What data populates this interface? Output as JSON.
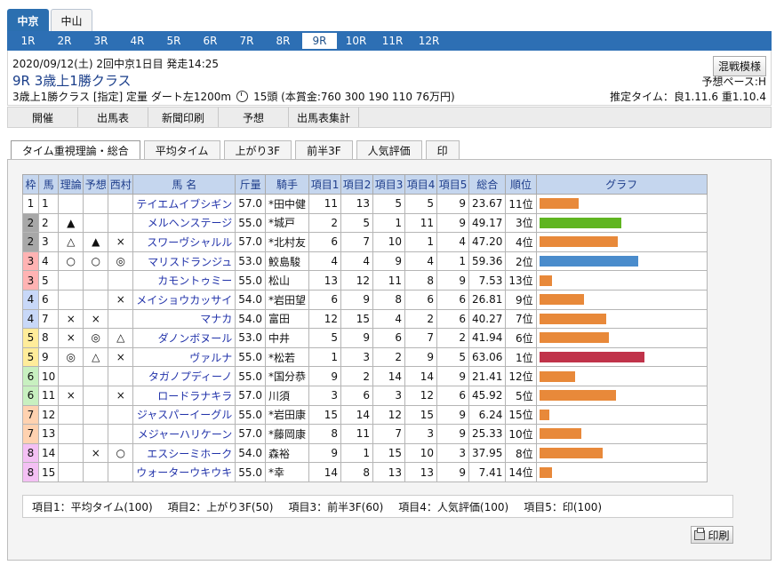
{
  "venue_tabs": [
    {
      "label": "中京",
      "active": true
    },
    {
      "label": "中山",
      "active": false
    }
  ],
  "race_tabs": [
    "1R",
    "2R",
    "3R",
    "4R",
    "5R",
    "6R",
    "7R",
    "8R",
    "9R",
    "10R",
    "11R",
    "12R"
  ],
  "active_race": "9R",
  "race": {
    "date_line": "2020/09/12(土) 2回中京1日目 発走14:25",
    "title": "9R 3歳上1勝クラス",
    "cond_left": "3歳上1勝クラス [指定] 定量 ダート左1200m",
    "cond_right": "15頭 (本賞金:760 300 190 110 76万円)",
    "konsen": "混戦模様",
    "pace": "予想ペース:H",
    "est_time": "推定タイム：良1.11.6 重1.10.4"
  },
  "sub_nav": [
    "開催",
    "出馬表",
    "新聞印刷",
    "予想",
    "出馬表集計"
  ],
  "content_tabs": [
    {
      "label": "タイム重視理論・総合",
      "active": true
    },
    {
      "label": "平均タイム"
    },
    {
      "label": "上がり3F"
    },
    {
      "label": "前半3F"
    },
    {
      "label": "人気評価"
    },
    {
      "label": "印"
    }
  ],
  "table": {
    "headers": [
      "枠",
      "馬",
      "理論",
      "予想",
      "西村",
      "馬 名",
      "斤量",
      "騎手",
      "項目1",
      "項目2",
      "項目3",
      "項目4",
      "項目5",
      "総合",
      "順位",
      "グラフ"
    ],
    "rows": [
      {
        "waku": "1",
        "uma": "1",
        "riron": "",
        "yoso": "",
        "nishi": "",
        "name": "テイエムイブシギン",
        "kin": "57.0",
        "jockey": "*田中健",
        "k1": "11",
        "k2": "13",
        "k3": "5",
        "k4": "5",
        "k5": "9",
        "total": "23.67",
        "rank": "11位",
        "bar": 23.67,
        "color": "orange"
      },
      {
        "waku": "2",
        "uma": "2",
        "riron": "▲",
        "yoso": "",
        "nishi": "",
        "name": "メルヘンステージ",
        "kin": "55.0",
        "jockey": "*城戸",
        "k1": "2",
        "k2": "5",
        "k3": "1",
        "k4": "11",
        "k5": "9",
        "total": "49.17",
        "rank": "3位",
        "bar": 49.17,
        "color": "green"
      },
      {
        "waku": "2",
        "uma": "3",
        "riron": "△",
        "yoso": "▲",
        "nishi": "×",
        "name": "スワーヴシャルル",
        "kin": "57.0",
        "jockey": "*北村友",
        "k1": "6",
        "k2": "7",
        "k3": "10",
        "k4": "1",
        "k5": "4",
        "total": "47.20",
        "rank": "4位",
        "bar": 47.2,
        "color": "orange"
      },
      {
        "waku": "3",
        "uma": "4",
        "riron": "○",
        "yoso": "○",
        "nishi": "◎",
        "name": "マリスドランジュ",
        "kin": "53.0",
        "jockey": "鮫島駿",
        "k1": "4",
        "k2": "4",
        "k3": "9",
        "k4": "4",
        "k5": "1",
        "total": "59.36",
        "rank": "2位",
        "bar": 59.36,
        "color": "blue"
      },
      {
        "waku": "3",
        "uma": "5",
        "riron": "",
        "yoso": "",
        "nishi": "",
        "name": "カモントゥミー",
        "kin": "55.0",
        "jockey": "松山",
        "k1": "13",
        "k2": "12",
        "k3": "11",
        "k4": "8",
        "k5": "9",
        "total": "7.53",
        "rank": "13位",
        "bar": 7.53,
        "color": "orange"
      },
      {
        "waku": "4",
        "uma": "6",
        "riron": "",
        "yoso": "",
        "nishi": "×",
        "name": "メイショウカッサイ",
        "kin": "54.0",
        "jockey": "*岩田望",
        "k1": "6",
        "k2": "9",
        "k3": "8",
        "k4": "6",
        "k5": "6",
        "total": "26.81",
        "rank": "9位",
        "bar": 26.81,
        "color": "orange"
      },
      {
        "waku": "4",
        "uma": "7",
        "riron": "×",
        "yoso": "×",
        "nishi": "",
        "name": "マナカ",
        "kin": "54.0",
        "jockey": "富田",
        "k1": "12",
        "k2": "15",
        "k3": "4",
        "k4": "2",
        "k5": "6",
        "total": "40.27",
        "rank": "7位",
        "bar": 40.27,
        "color": "orange"
      },
      {
        "waku": "5",
        "uma": "8",
        "riron": "×",
        "yoso": "◎",
        "nishi": "△",
        "name": "ダノンボヌール",
        "kin": "53.0",
        "jockey": "中井",
        "k1": "5",
        "k2": "9",
        "k3": "6",
        "k4": "7",
        "k5": "2",
        "total": "41.94",
        "rank": "6位",
        "bar": 41.94,
        "color": "orange"
      },
      {
        "waku": "5",
        "uma": "9",
        "riron": "◎",
        "yoso": "△",
        "nishi": "×",
        "name": "ヴァルナ",
        "kin": "55.0",
        "jockey": "*松若",
        "k1": "1",
        "k2": "3",
        "k3": "2",
        "k4": "9",
        "k5": "5",
        "total": "63.06",
        "rank": "1位",
        "bar": 63.06,
        "color": "red"
      },
      {
        "waku": "6",
        "uma": "10",
        "riron": "",
        "yoso": "",
        "nishi": "",
        "name": "タガノプディーノ",
        "kin": "55.0",
        "jockey": "*国分恭",
        "k1": "9",
        "k2": "2",
        "k3": "14",
        "k4": "14",
        "k5": "9",
        "total": "21.41",
        "rank": "12位",
        "bar": 21.41,
        "color": "orange"
      },
      {
        "waku": "6",
        "uma": "11",
        "riron": "×",
        "yoso": "",
        "nishi": "×",
        "name": "ロードラナキラ",
        "kin": "57.0",
        "jockey": "川須",
        "k1": "3",
        "k2": "6",
        "k3": "3",
        "k4": "12",
        "k5": "6",
        "total": "45.92",
        "rank": "5位",
        "bar": 45.92,
        "color": "orange"
      },
      {
        "waku": "7",
        "uma": "12",
        "riron": "",
        "yoso": "",
        "nishi": "",
        "name": "ジャスパーイーグル",
        "kin": "55.0",
        "jockey": "*岩田康",
        "k1": "15",
        "k2": "14",
        "k3": "12",
        "k4": "15",
        "k5": "9",
        "total": "6.24",
        "rank": "15位",
        "bar": 6.24,
        "color": "orange"
      },
      {
        "waku": "7",
        "uma": "13",
        "riron": "",
        "yoso": "",
        "nishi": "",
        "name": "メジャーハリケーン",
        "kin": "57.0",
        "jockey": "*藤岡康",
        "k1": "8",
        "k2": "11",
        "k3": "7",
        "k4": "3",
        "k5": "9",
        "total": "25.33",
        "rank": "10位",
        "bar": 25.33,
        "color": "orange"
      },
      {
        "waku": "8",
        "uma": "14",
        "riron": "",
        "yoso": "×",
        "nishi": "○",
        "name": "エスシーミホーク",
        "kin": "54.0",
        "jockey": "森裕",
        "k1": "9",
        "k2": "1",
        "k3": "15",
        "k4": "10",
        "k5": "3",
        "total": "37.95",
        "rank": "8位",
        "bar": 37.95,
        "color": "orange"
      },
      {
        "waku": "8",
        "uma": "15",
        "riron": "",
        "yoso": "",
        "nishi": "",
        "name": "ウォーターウキウキ",
        "kin": "55.0",
        "jockey": "*幸",
        "k1": "14",
        "k2": "8",
        "k3": "13",
        "k4": "13",
        "k5": "9",
        "total": "7.41",
        "rank": "14位",
        "bar": 7.41,
        "color": "orange"
      }
    ]
  },
  "highlights": {
    "1": {
      "k1": "blue",
      "k3": "pink"
    },
    "2": {
      "k4": "pink"
    },
    "3": {
      "k5": "pink"
    },
    "6": {
      "k4": "blue"
    },
    "7": {
      "k5": "blue"
    },
    "8": {
      "k1": "pink",
      "k2": "green",
      "k3": "blue"
    },
    "9": {
      "k2": "blue"
    },
    "10": {
      "k1": "green",
      "k3": "green"
    },
    "12": {
      "k4": "green"
    },
    "13": {
      "k2": "pink",
      "k5": "green"
    }
  },
  "waku_colors": {
    "1": "#ffffff",
    "2": "#a8a8a8",
    "3": "#ffb3b3",
    "4": "#c8d8f8",
    "5": "#ffec9a",
    "6": "#c8f0c0",
    "7": "#ffd2b0",
    "8": "#f4c0f4"
  },
  "bar_colors": {
    "orange": "#e8893a",
    "green": "#5fb520",
    "blue": "#4a8ccc",
    "red": "#c0334a"
  },
  "legend": [
    "項目1：平均タイム(100)",
    "項目2：上がり3F(50)",
    "項目3：前半3F(60)",
    "項目4：人気評価(100)",
    "項目5：印(100)"
  ],
  "print_label": "印刷"
}
